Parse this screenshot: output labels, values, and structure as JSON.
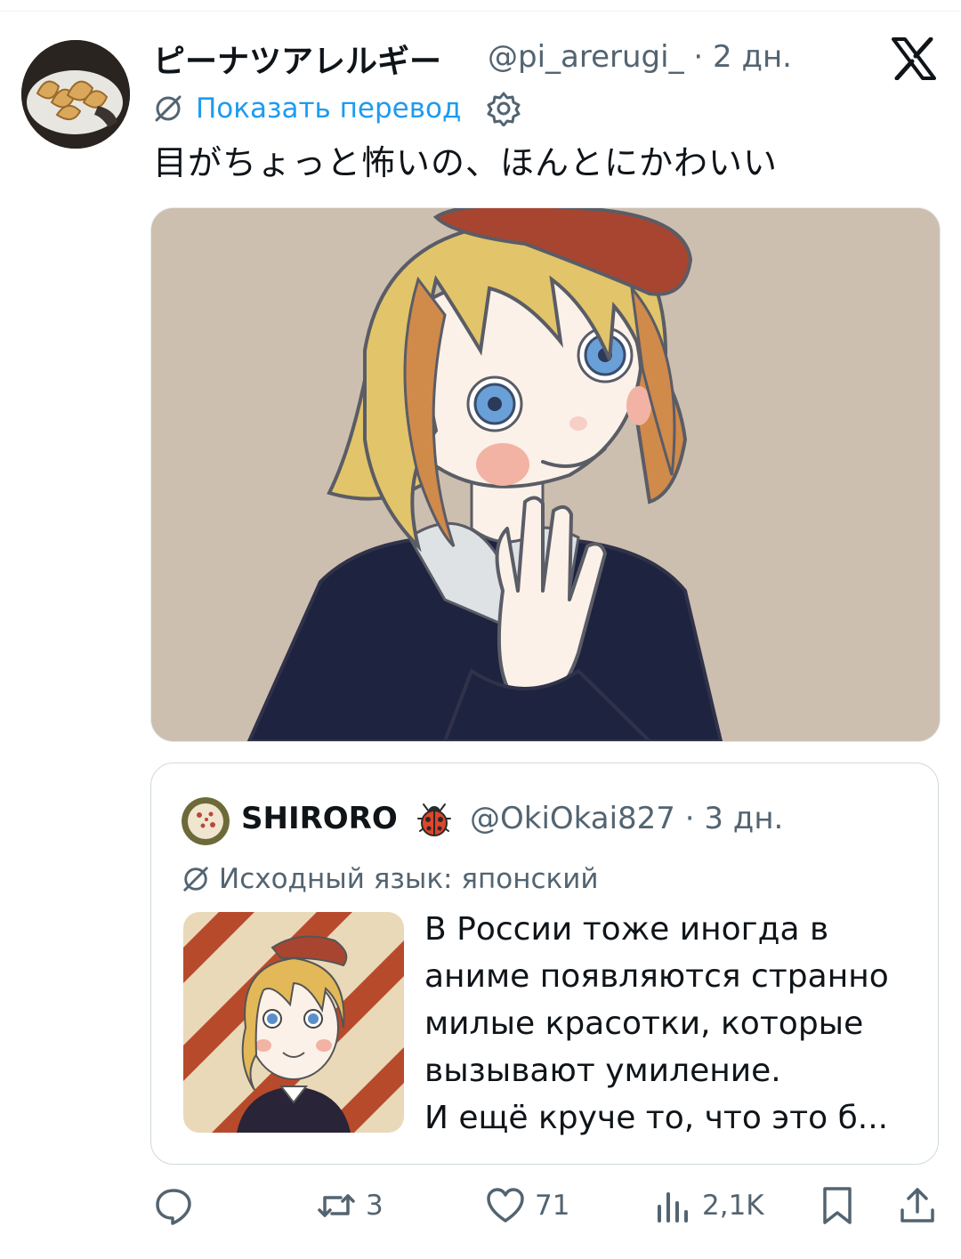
{
  "tweet": {
    "author_name": "ピーナツアレルギー",
    "handle": "@pi_arerugi_",
    "time": "· 2 дн.",
    "translate_label": "Показать перевод",
    "text": "目がちょっと怖いの、ほんとにかわいい"
  },
  "quote": {
    "author_name": "SHIRORO",
    "handle": "@OkiOkai827",
    "time": "· 3 дн.",
    "language_label": "Исходный язык: японский",
    "text": "В России тоже иногда в\nаниме появляются странно\nмилые красотки, которые\nвызывают умиление.\nИ ещё круче то, что это б..."
  },
  "actions": {
    "replies": "",
    "retweets": "3",
    "likes": "71",
    "views": "2,1K"
  },
  "icons": [
    "x-logo-icon",
    "translate-icon",
    "gear-icon",
    "ladybug-icon",
    "reply-icon",
    "retweet-icon",
    "like-icon",
    "views-icon",
    "bookmark-icon",
    "share-icon"
  ],
  "colors": {
    "link": "#1d9bf0",
    "secondary_text": "#536471",
    "image_background": "#cdbfaf",
    "border": "#cfd9de"
  }
}
